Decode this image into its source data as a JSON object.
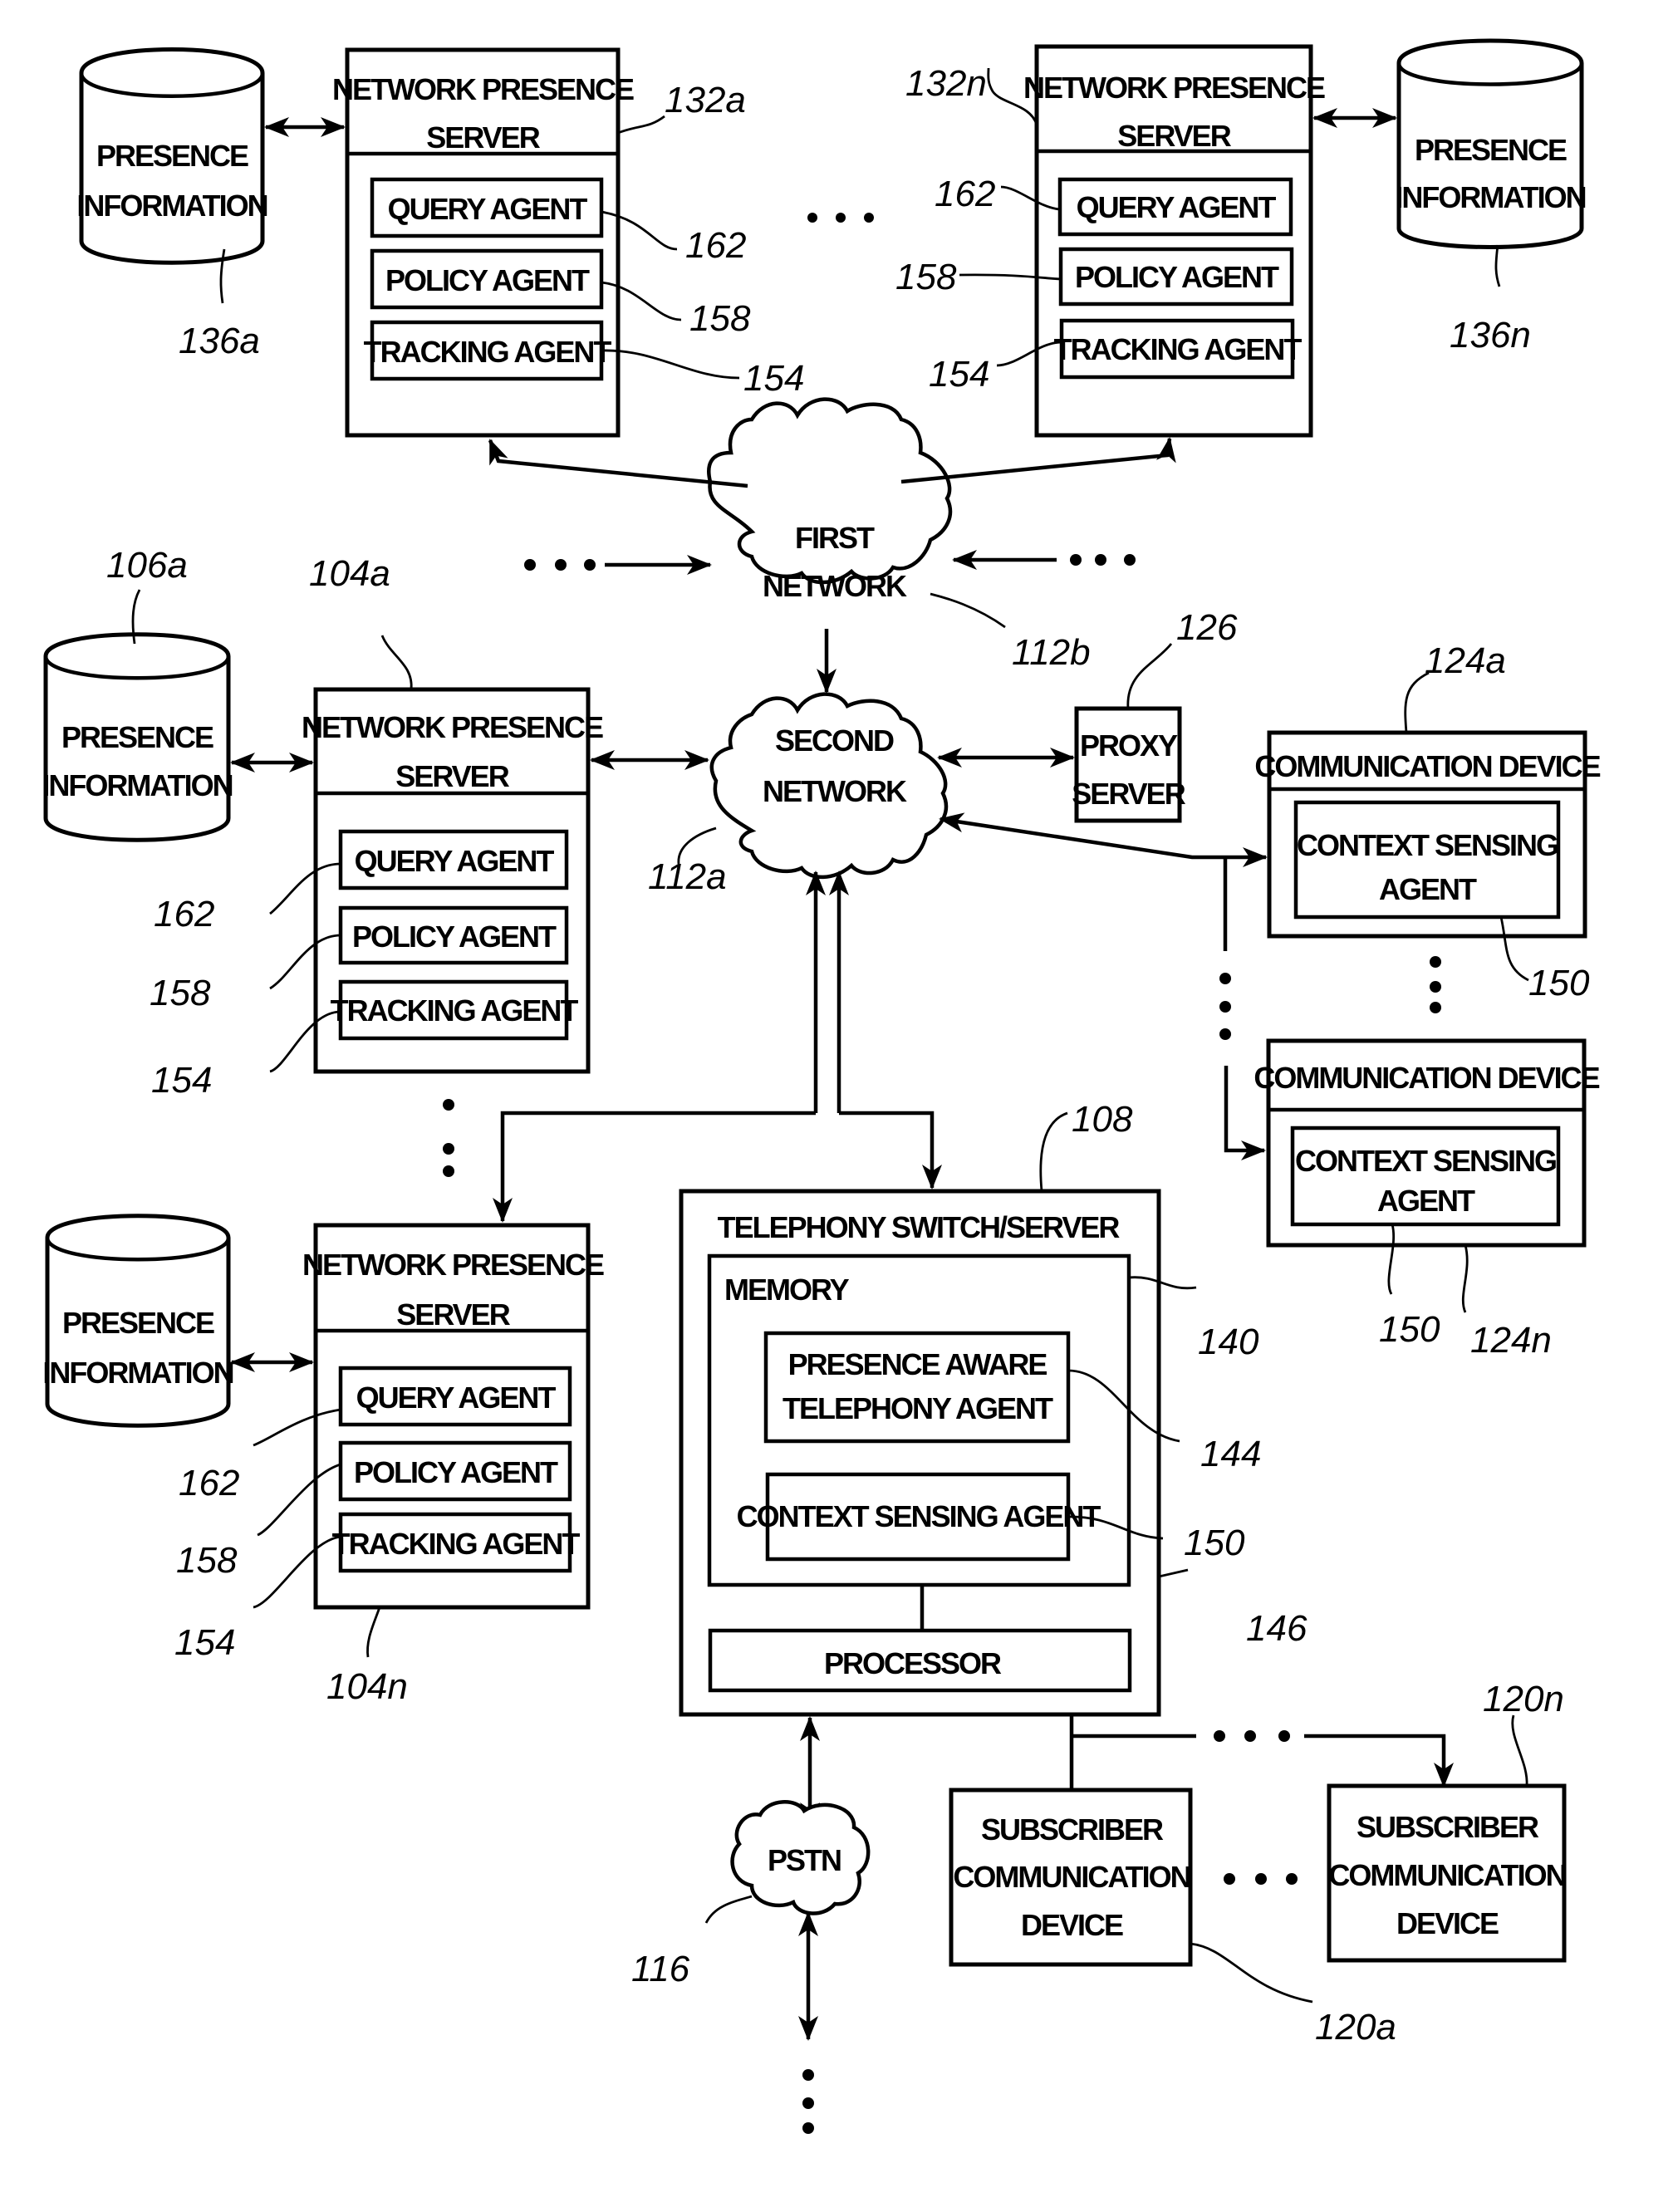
{
  "figure": {
    "type": "patent block diagram",
    "subject": "presence-aware telephony network architecture"
  },
  "network_presence_servers": [
    {
      "ref": "132a",
      "title_line1": "NETWORK PRESENCE",
      "title_line2": "SERVER",
      "agents": [
        {
          "label": "QUERY AGENT",
          "ref": "162"
        },
        {
          "label": "POLICY AGENT",
          "ref": "158"
        },
        {
          "label": "TRACKING AGENT",
          "ref": "154"
        }
      ],
      "db": {
        "line1": "PRESENCE",
        "line2": "INFORMATION",
        "ref": "136a"
      }
    },
    {
      "ref": "132n",
      "title_line1": "NETWORK PRESENCE",
      "title_line2": "SERVER",
      "agents": [
        {
          "label": "QUERY AGENT",
          "ref": "162"
        },
        {
          "label": "POLICY AGENT",
          "ref": "158"
        },
        {
          "label": "TRACKING AGENT",
          "ref": "154"
        }
      ],
      "db": {
        "line1": "PRESENCE",
        "line2": "INFORMATION",
        "ref": "136n"
      }
    },
    {
      "ref": "104a",
      "title_line1": "NETWORK PRESENCE",
      "title_line2": "SERVER",
      "agents": [
        {
          "label": "QUERY AGENT",
          "ref": "162"
        },
        {
          "label": "POLICY AGENT",
          "ref": "158"
        },
        {
          "label": "TRACKING AGENT",
          "ref": "154"
        }
      ],
      "db": {
        "line1": "PRESENCE",
        "line2": "INFORMATION",
        "ref": "106a"
      }
    },
    {
      "ref": "104n",
      "title_line1": "NETWORK PRESENCE",
      "title_line2": "SERVER",
      "agents": [
        {
          "label": "QUERY AGENT",
          "ref": "162"
        },
        {
          "label": "POLICY AGENT",
          "ref": "158"
        },
        {
          "label": "TRACKING AGENT",
          "ref": "154"
        }
      ],
      "db": {
        "line1": "PRESENCE",
        "line2": "INFORMATION",
        "ref": ""
      }
    }
  ],
  "networks": {
    "first": {
      "line1": "FIRST",
      "line2": "NETWORK",
      "ref": "112b"
    },
    "second": {
      "line1": "SECOND",
      "line2": "NETWORK",
      "ref": "112a"
    },
    "pstn": {
      "label": "PSTN",
      "ref": "116"
    }
  },
  "proxy_server": {
    "line1": "PROXY",
    "line2": "SERVER",
    "ref": "126"
  },
  "communication_devices": [
    {
      "title": "COMMUNICATION DEVICE",
      "agent_line1": "CONTEXT SENSING",
      "agent_line2": "AGENT",
      "ref": "124a",
      "agent_ref": "150"
    },
    {
      "title": "COMMUNICATION DEVICE",
      "agent_line1": "CONTEXT SENSING",
      "agent_line2": "AGENT",
      "ref": "124n",
      "agent_ref": "150"
    }
  ],
  "telephony_switch": {
    "title": "TELEPHONY SWITCH/SERVER",
    "ref": "108",
    "memory": {
      "label": "MEMORY",
      "ref": "140"
    },
    "presence_agent": {
      "line1": "PRESENCE AWARE",
      "line2": "TELEPHONY AGENT",
      "ref": "144"
    },
    "context_agent": {
      "label": "CONTEXT SENSING AGENT",
      "ref": "150"
    },
    "processor": {
      "label": "PROCESSOR",
      "ref": "146"
    }
  },
  "subscriber_devices": [
    {
      "line1": "SUBSCRIBER",
      "line2": "COMMUNICATION",
      "line3": "DEVICE",
      "ref": "120a"
    },
    {
      "line1": "SUBSCRIBER",
      "line2": "COMMUNICATION",
      "line3": "DEVICE",
      "ref": "120n"
    }
  ]
}
